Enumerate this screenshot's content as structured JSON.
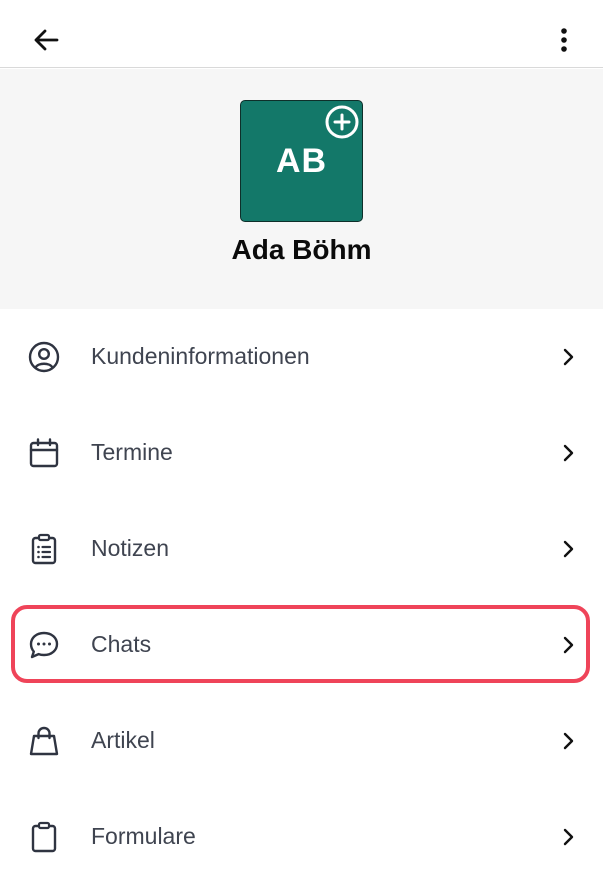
{
  "header": {
    "back_icon": "arrow-left-icon",
    "more_icon": "more-vertical-icon"
  },
  "profile": {
    "initials": "AB",
    "name": "Ada Böhm",
    "avatar_color": "#137869",
    "add_icon": "plus-circle-icon"
  },
  "menu": {
    "items": [
      {
        "label": "Kundeninformationen",
        "icon": "user-circle-icon"
      },
      {
        "label": "Termine",
        "icon": "calendar-icon"
      },
      {
        "label": "Notizen",
        "icon": "clipboard-list-icon"
      },
      {
        "label": "Chats",
        "icon": "chat-bubble-icon"
      },
      {
        "label": "Artikel",
        "icon": "shopping-bag-icon"
      },
      {
        "label": "Formulare",
        "icon": "clipboard-icon"
      }
    ],
    "highlighted_index": 3,
    "highlight_color": "#ef4459"
  }
}
